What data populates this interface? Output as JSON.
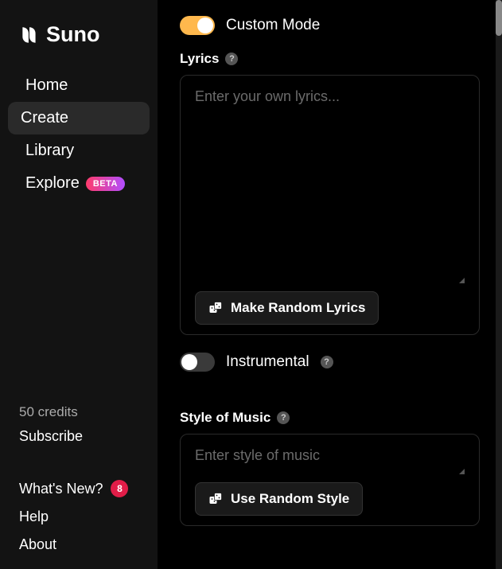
{
  "brand": {
    "name": "Suno"
  },
  "sidebar": {
    "items": [
      {
        "label": "Home",
        "active": false
      },
      {
        "label": "Create",
        "active": true
      },
      {
        "label": "Library",
        "active": false
      },
      {
        "label": "Explore",
        "active": false,
        "badge": "BETA"
      }
    ],
    "credits_label": "50 credits",
    "subscribe_label": "Subscribe",
    "footer": [
      {
        "label": "What's New?",
        "badge": "8"
      },
      {
        "label": "Help"
      },
      {
        "label": "About"
      }
    ]
  },
  "main": {
    "custom_mode": {
      "label": "Custom Mode",
      "on": true
    },
    "lyrics": {
      "label": "Lyrics",
      "placeholder": "Enter your own lyrics...",
      "value": "",
      "random_button": "Make Random Lyrics"
    },
    "instrumental": {
      "label": "Instrumental",
      "on": false
    },
    "style": {
      "label": "Style of Music",
      "placeholder": "Enter style of music",
      "value": "",
      "random_button": "Use Random Style"
    }
  }
}
